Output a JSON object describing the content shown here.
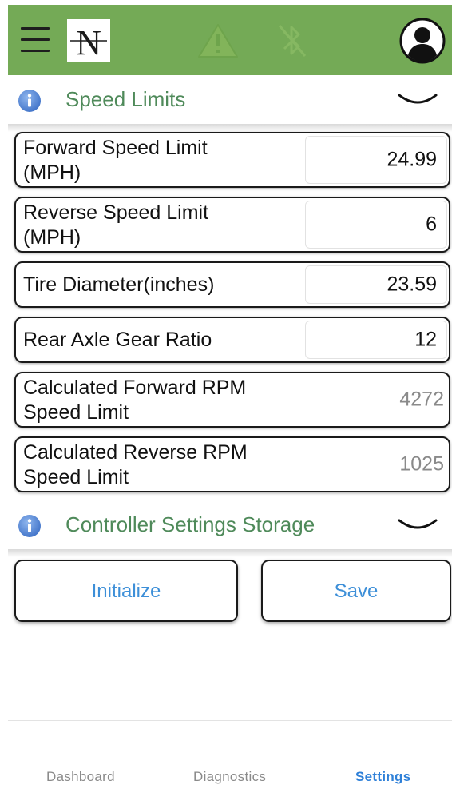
{
  "header": {
    "logo_letter": "N",
    "icons": [
      "hamburger-menu-icon",
      "warning-icon",
      "bluetooth-icon",
      "account-icon"
    ],
    "color": "#74aa56"
  },
  "speed_limits": {
    "title": "Speed Limits",
    "rows": [
      {
        "label_line1": "Forward Speed Limit",
        "label_line2": "(MPH)",
        "value": "24.99",
        "editable": true
      },
      {
        "label_line1": "Reverse Speed Limit",
        "label_line2": "(MPH)",
        "value": "6",
        "editable": true
      },
      {
        "label_line1": "Tire Diameter(inches)",
        "value": "23.59",
        "editable": true
      },
      {
        "label_line1": "Rear Axle Gear Ratio",
        "value": "12",
        "editable": true
      },
      {
        "label_line1": "Calculated Forward RPM",
        "label_line2": "Speed Limit",
        "value": "4272",
        "editable": false
      },
      {
        "label_line1": "Calculated Reverse RPM",
        "label_line2": "Speed Limit",
        "value": "1025",
        "editable": false
      }
    ]
  },
  "storage": {
    "title": "Controller Settings Storage",
    "initialize_label": "Initialize",
    "save_label": "Save"
  },
  "tabs": [
    {
      "label": "Dashboard",
      "active": false
    },
    {
      "label": "Diagnostics",
      "active": false
    },
    {
      "label": "Settings",
      "active": true
    }
  ],
  "colors": {
    "accent_green": "#74aa56",
    "section_title": "#4f8a5a",
    "link_blue": "#3d8fd8",
    "active_tab": "#2f80d8"
  }
}
